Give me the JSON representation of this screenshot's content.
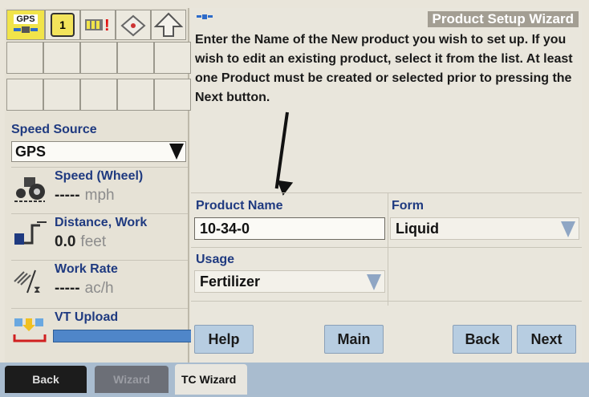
{
  "status_bar": {
    "gps_label": "GPS",
    "section_count": "1"
  },
  "speed_source": {
    "label": "Speed Source",
    "value": "GPS"
  },
  "metrics": [
    {
      "title": "Speed (Wheel)",
      "value": "-----",
      "unit": "mph"
    },
    {
      "title": "Distance, Work",
      "value": "0.0",
      "unit": "feet"
    },
    {
      "title": "Work Rate",
      "value": "-----",
      "unit": "ac/h"
    },
    {
      "title": "VT Upload",
      "progress": 1.0
    }
  ],
  "tabs": {
    "back": "Back",
    "wizard": "Wizard",
    "tc_wizard": "TC Wizard"
  },
  "wizard": {
    "title": "Product Setup Wizard",
    "instructions": "Enter the Name of the New product you wish to set up. If you wish to edit an existing product, select it from the list. At least one Product must be created or selected prior to pressing the Next button.",
    "fields": {
      "product_name_label": "Product Name",
      "product_name_value": "10-34-0",
      "form_label": "Form",
      "form_value": "Liquid",
      "usage_label": "Usage",
      "usage_value": "Fertilizer"
    },
    "buttons": {
      "help": "Help",
      "main": "Main",
      "back": "Back",
      "next": "Next"
    }
  },
  "colors": {
    "accent_label": "#1f3a80",
    "button_bg": "#b7cde1",
    "gps_bg": "#f1e44a"
  }
}
